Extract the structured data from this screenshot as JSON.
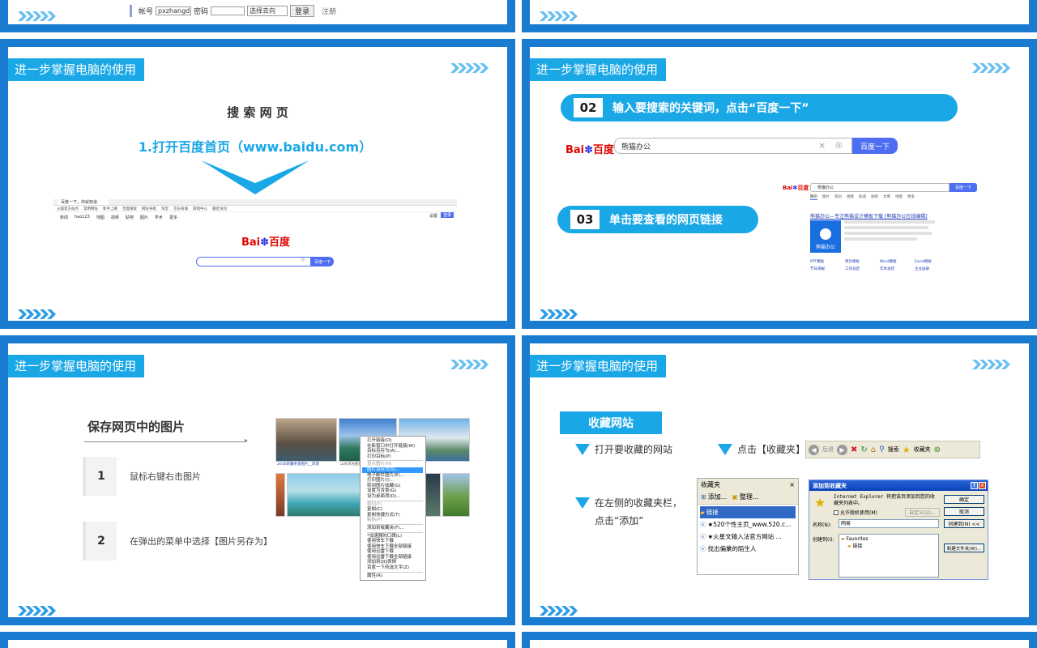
{
  "top_left": {
    "login_bar": {
      "account_label": "帐号",
      "account_value": "pxzhangd",
      "password_label": "密码",
      "direction_select": "选择去向",
      "login_button": "登录",
      "register_link": "注册"
    }
  },
  "slides": {
    "s1": {
      "title": "进一步掌握电脑的使用",
      "heading": "搜 索 网 页",
      "step": "1.打开百度首页（www.baidu.com）",
      "browser_tab": "百度一下，你就知道",
      "bookmarks": [
        "火狐官方站点",
        "常用网址",
        "新手上路",
        "百度搜索",
        "网址导航",
        "淘宝",
        "京东商城",
        "游戏中心",
        "最近访问"
      ],
      "nav_links": [
        "新闻",
        "hao123",
        "地图",
        "视频",
        "贴吧",
        "图片",
        "学术",
        "更多"
      ],
      "right_links": [
        "设置"
      ],
      "login_btn": "登录",
      "logo_text": "Bai",
      "logo_text2": "百度",
      "search_btn": "百度一下"
    },
    "s2": {
      "title": "进一步掌握电脑的使用",
      "step2_num": "02",
      "step2_text": "输入要搜索的关键词，点击“百度一下”",
      "search_value": "熊猫办公",
      "search_btn": "百度一下",
      "step3_num": "03",
      "step3_text": "单击要查看的网页链接",
      "result_tabs": [
        "网页",
        "图片",
        "资讯",
        "视频",
        "知道",
        "贴吧",
        "文库",
        "地图",
        "更多"
      ],
      "result_title": "熊猫办公—专注熊猫设计模板下载 [熊猫办公在线编辑]",
      "result_brand": "熊猫办公",
      "result_links": [
        "PPT模板",
        "简历模板",
        "Word模板",
        "Excel模板",
        "节日海报",
        "工作总结",
        "年终总结",
        "企业画册"
      ]
    },
    "s3": {
      "title": "进一步掌握电脑的使用",
      "heading": "保存网页中的图片",
      "step1_num": "1",
      "step1_text": "鼠标右键右击图片",
      "step2_num": "2",
      "step2_text": "在弹出的菜单中选择【图片另存为】",
      "menu_items": [
        "打开链接(O)",
        "在新窗口中打开链接(W)",
        "目标另存为(A)...",
        "打印目标(P)",
        "显示图片(H)",
        "图片另存为(S)...",
        "电子邮件图片(E)...",
        "打印图片(I)...",
        "转到图片收藏(G)",
        "设置为背景(G)",
        "设为桌面项(D)...",
        "剪切(T)",
        "复制(C)",
        "复制快捷方式(T)",
        "粘贴(P)",
        "添加到收藏夹(F)...",
        "*加速器的口碑(L)",
        "使用快车下载",
        "使用快车下载全部链接",
        "使用迅雷下载",
        "使用迅雷下载全部链接",
        "添加到QQ表情",
        "百度一下药选文字(Z)",
        "属性(R)"
      ],
      "thumb_caption_1": "2016新疆冬景图片__风景",
      "thumb_caption_2": "山水风光图片"
    },
    "s4": {
      "title": "进一步掌握电脑的使用",
      "heading": "收藏网站",
      "step_a": "打开要收藏的网站",
      "step_b": "点击【收藏夹】",
      "step_c_line1": "在左侧的收藏夹栏，",
      "step_c_line2": "点击“添加”",
      "toolbar_back": "后退",
      "toolbar_search": "搜索",
      "toolbar_fav": "收藏夹",
      "fav_panel_title": "收藏夹",
      "fav_add": "添加...",
      "fav_organize": "整理...",
      "fav_close": "×",
      "fav_items": [
        "链接",
        "★520个性主页_www.520.c...",
        "★火星文输入法官方网站 ...",
        "找出偏業的陌生人"
      ],
      "dlg_title": "添加到收藏夹",
      "dlg_msg": "Internet Explorer 将把该页添加到您的收藏夹列表中。",
      "dlg_offline": "允许脱机使用(M)",
      "dlg_customize": "自定义(U)...",
      "dlg_ok": "确定",
      "dlg_cancel": "取消",
      "dlg_create_in": "创建到(N) <<",
      "dlg_name_label": "名称(N):",
      "dlg_name_value": "网易",
      "dlg_createin_label": "创建到(I):",
      "dlg_tree_root": "Favorites",
      "dlg_tree_child": "链接",
      "dlg_new_folder": "新建文件夹(W)..."
    }
  }
}
